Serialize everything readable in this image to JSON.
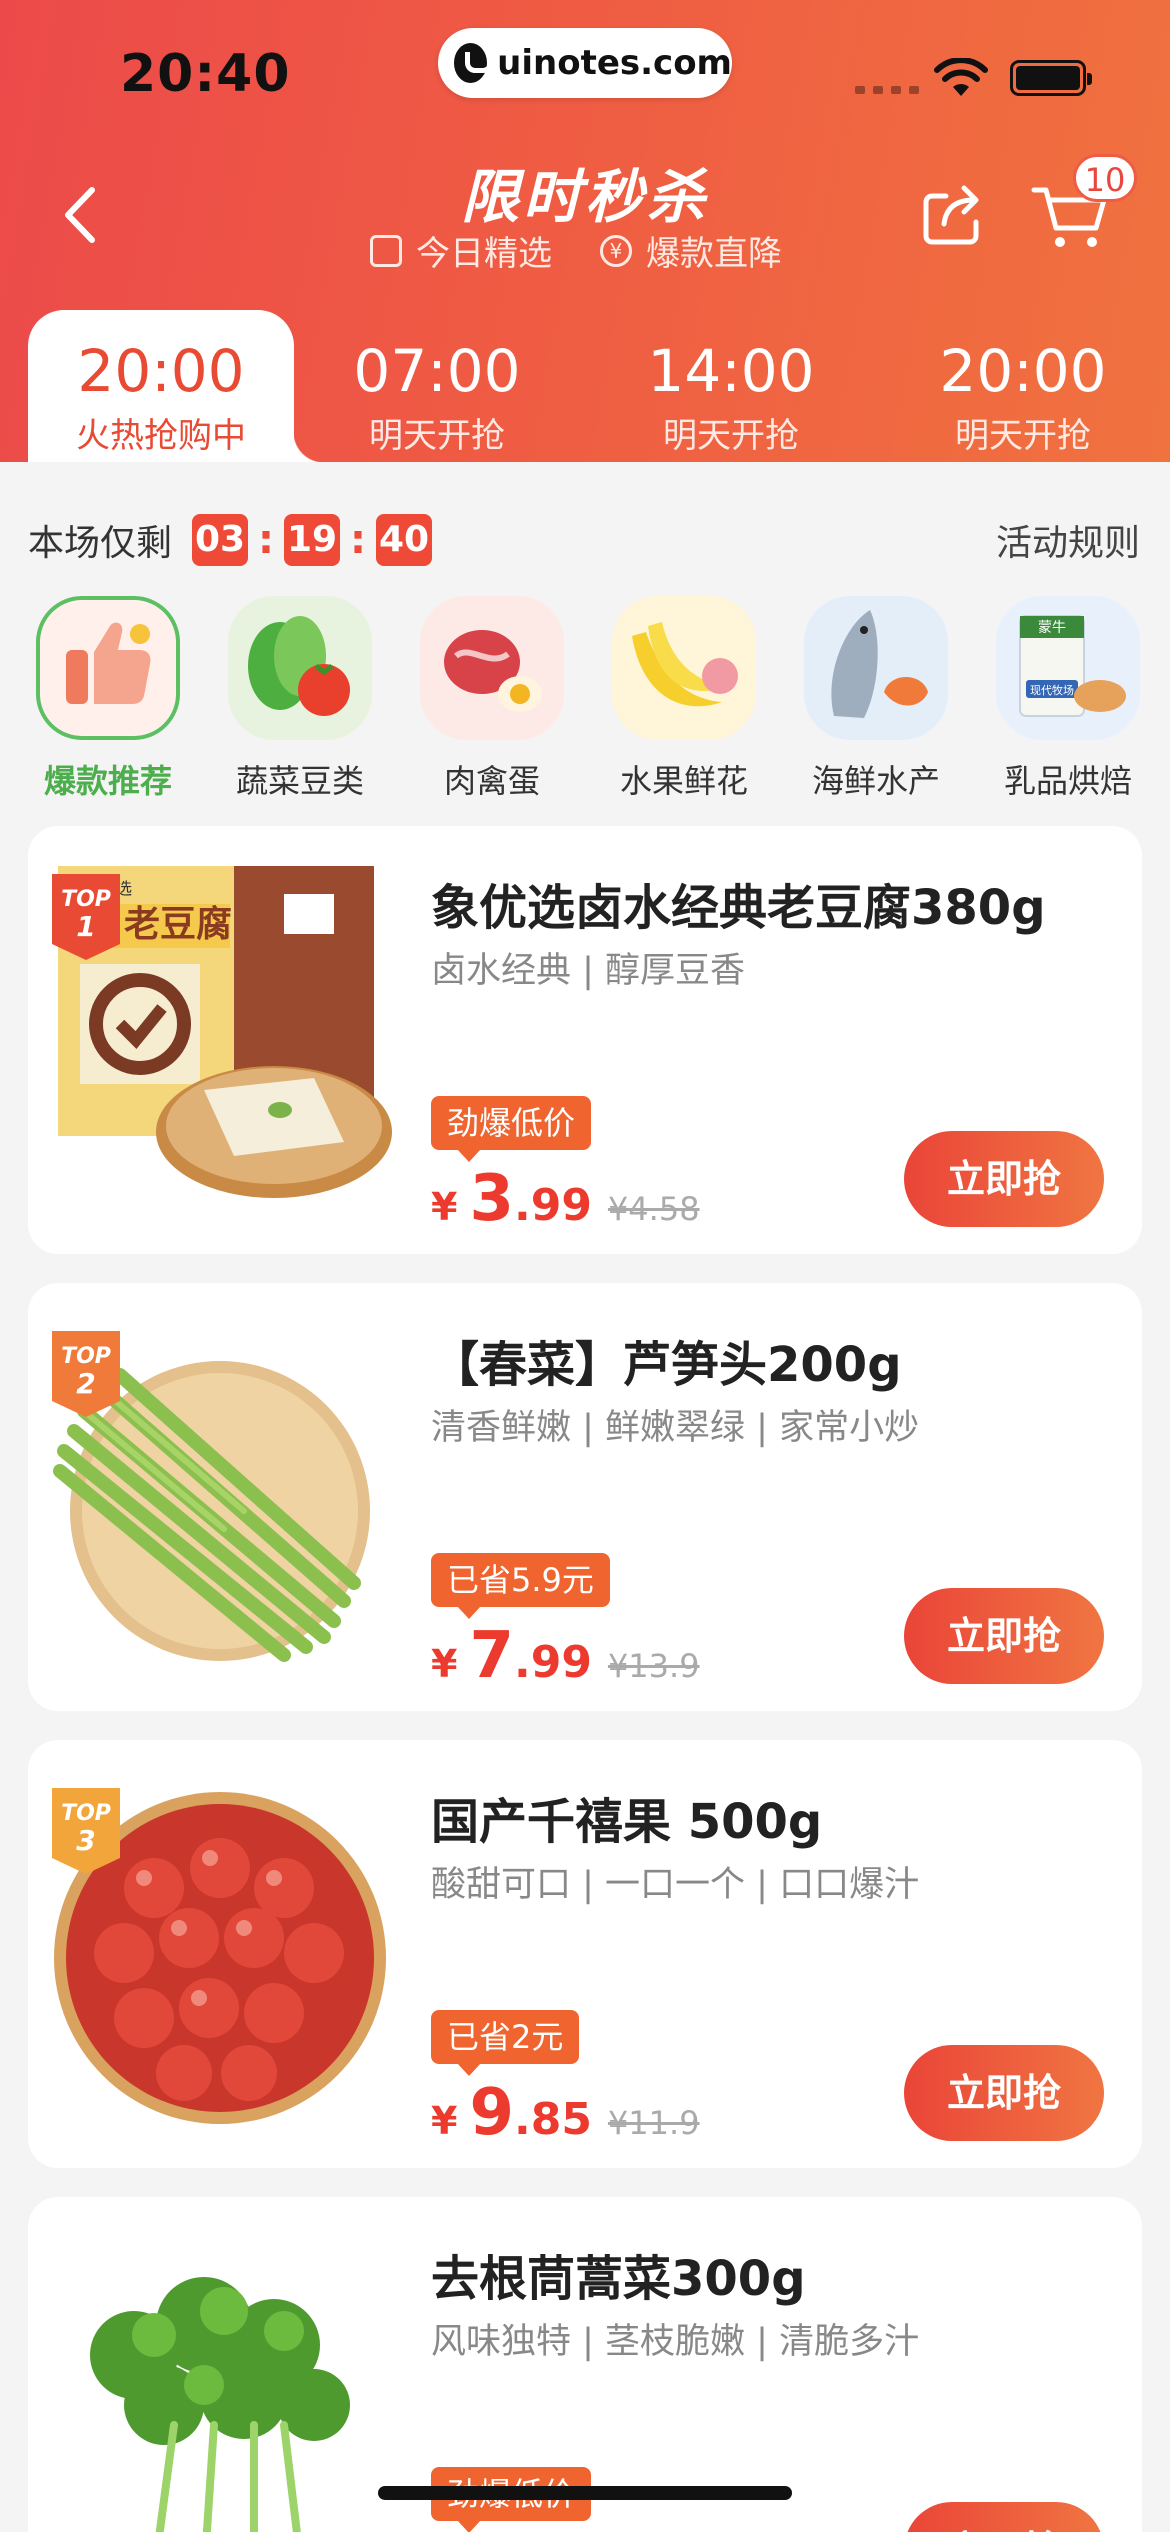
{
  "status_bar": {
    "time": "20:40",
    "url": "uinotes.com"
  },
  "header": {
    "title": "限时秒杀",
    "tags": [
      "今日精选",
      "爆款直降"
    ],
    "cart_count": "10"
  },
  "tabs": [
    {
      "time": "20:00",
      "status": "火热抢购中",
      "active": true
    },
    {
      "time": "07:00",
      "status": "明天开抢"
    },
    {
      "time": "14:00",
      "status": "明天开抢"
    },
    {
      "time": "20:00",
      "status": "明天开抢"
    }
  ],
  "countdown": {
    "label": "本场仅剩",
    "hours": "03",
    "minutes": "19",
    "seconds": "40",
    "rules": "活动规则"
  },
  "categories": [
    {
      "label": "爆款推荐",
      "icon": "thumbs-up-icon",
      "active": true
    },
    {
      "label": "蔬菜豆类",
      "icon": "vegetable-icon"
    },
    {
      "label": "肉禽蛋",
      "icon": "meat-egg-icon"
    },
    {
      "label": "水果鲜花",
      "icon": "banana-icon"
    },
    {
      "label": "海鲜水产",
      "icon": "fish-icon"
    },
    {
      "label": "乳品烘焙",
      "icon": "milk-bread-icon"
    }
  ],
  "products": [
    {
      "rank": "TOP 1",
      "name": "象优选卤水经典老豆腐380g",
      "desc": "卤水经典 | 醇厚豆香",
      "promo": "劲爆低价",
      "currency": "¥",
      "price_int": "3",
      "price_dec": ".99",
      "orig": "¥4.58",
      "buy": "立即抢"
    },
    {
      "rank": "TOP 2",
      "name": "【春菜】芦笋头200g",
      "desc": "清香鲜嫩 | 鲜嫩翠绿 | 家常小炒",
      "promo": "已省5.9元",
      "currency": "¥",
      "price_int": "7",
      "price_dec": ".99",
      "orig": "¥13.9",
      "buy": "立即抢"
    },
    {
      "rank": "TOP 3",
      "name": "国产千禧果 500g",
      "desc": "酸甜可口 | 一口一个 | 口口爆汁",
      "promo": "已省2元",
      "currency": "¥",
      "price_int": "9",
      "price_dec": ".85",
      "orig": "¥11.9",
      "buy": "立即抢"
    },
    {
      "rank": "",
      "name": "去根茼蒿菜300g",
      "desc": "风味独特 | 茎枝脆嫩 | 清脆多汁",
      "promo": "劲爆低价",
      "buy": "立即抢"
    }
  ],
  "packaging": {
    "tofu_label": "老豆腐",
    "tofu_brand": "象优选",
    "milk_brand": "蒙牛",
    "milk_sub": "现代牧场"
  }
}
